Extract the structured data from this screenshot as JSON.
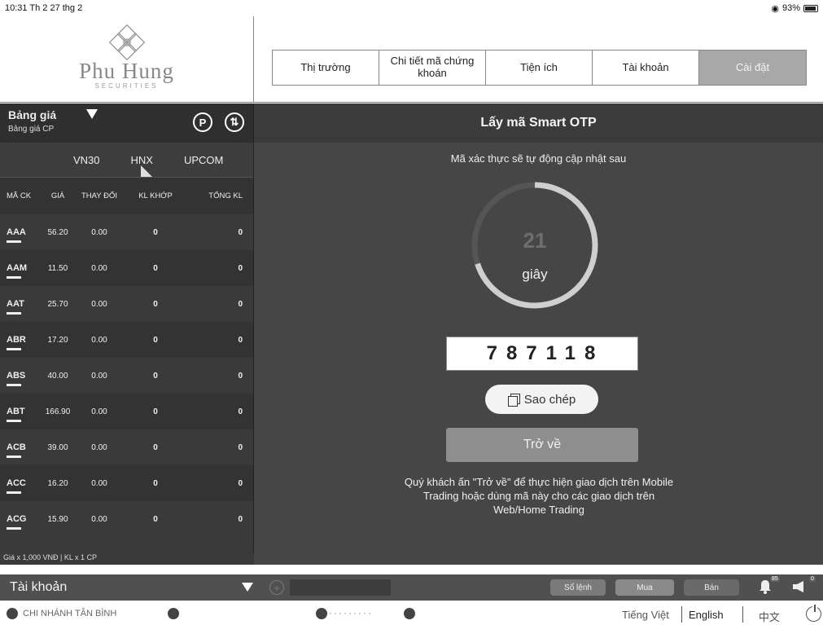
{
  "status_bar": {
    "time": "10:31",
    "date": "Th 2 27 thg 2",
    "battery": "93%"
  },
  "brand": {
    "name": "Phu Hung",
    "tagline": "SECURITIES"
  },
  "nav": {
    "tabs": [
      {
        "label": "Thị trường"
      },
      {
        "label": "Chi tiết mã chứng khoán"
      },
      {
        "label": "Tiện ích"
      },
      {
        "label": "Tài khoản"
      },
      {
        "label": "Cài đặt"
      }
    ],
    "active_index": 4
  },
  "board": {
    "title": "Bảng giá",
    "subtitle": "Bảng giá CP",
    "exchanges": [
      "VN30",
      "HNX",
      "UPCOM"
    ],
    "columns": [
      "MÃ CK",
      "GIÁ",
      "THAY ĐỔI",
      "KL KHỚP",
      "TỔNG KL"
    ],
    "rows": [
      {
        "code": "AAA",
        "price": "56.20",
        "change": "0.00",
        "volume": "0",
        "total": "0"
      },
      {
        "code": "AAM",
        "price": "11.50",
        "change": "0.00",
        "volume": "0",
        "total": "0"
      },
      {
        "code": "AAT",
        "price": "25.70",
        "change": "0.00",
        "volume": "0",
        "total": "0"
      },
      {
        "code": "ABR",
        "price": "17.20",
        "change": "0.00",
        "volume": "0",
        "total": "0"
      },
      {
        "code": "ABS",
        "price": "40.00",
        "change": "0.00",
        "volume": "0",
        "total": "0"
      },
      {
        "code": "ABT",
        "price": "166.90",
        "change": "0.00",
        "volume": "0",
        "total": "0"
      },
      {
        "code": "ACB",
        "price": "39.00",
        "change": "0.00",
        "volume": "0",
        "total": "0"
      },
      {
        "code": "ACC",
        "price": "16.20",
        "change": "0.00",
        "volume": "0",
        "total": "0"
      },
      {
        "code": "ACG",
        "price": "15.90",
        "change": "0.00",
        "volume": "0",
        "total": "0"
      }
    ],
    "footnote": "Giá x 1,000 VNĐ | KL x 1 CP"
  },
  "otp": {
    "title": "Lấy mã Smart OTP",
    "subtitle": "Mã xác thực sẽ tự động cập nhật sau",
    "seconds": "21",
    "seconds_unit": "giây",
    "remaining_fraction": 0.7,
    "code": "787118",
    "copy_label": "Sao chép",
    "back_label": "Trở về",
    "note": "Quý khách ấn \"Trở về\" để thực hiện giao dịch trên Mobile Trading hoặc dùng mã này cho các giao dịch trên Web/Home Trading"
  },
  "account_bar": {
    "label": "Tài khoản",
    "order_book": "Sổ lệnh",
    "buy": "Mua",
    "sell": "Bán",
    "notif_count": "85",
    "announce_count": "0"
  },
  "footer": {
    "branch": "CHI NHÁNH TÂN BÌNH",
    "languages": [
      "Tiếng Việt",
      "English",
      "中文"
    ]
  },
  "colors": {
    "active_tab": "#a8a8a8",
    "panel": "#464646",
    "ring": "#cfcfcf"
  }
}
